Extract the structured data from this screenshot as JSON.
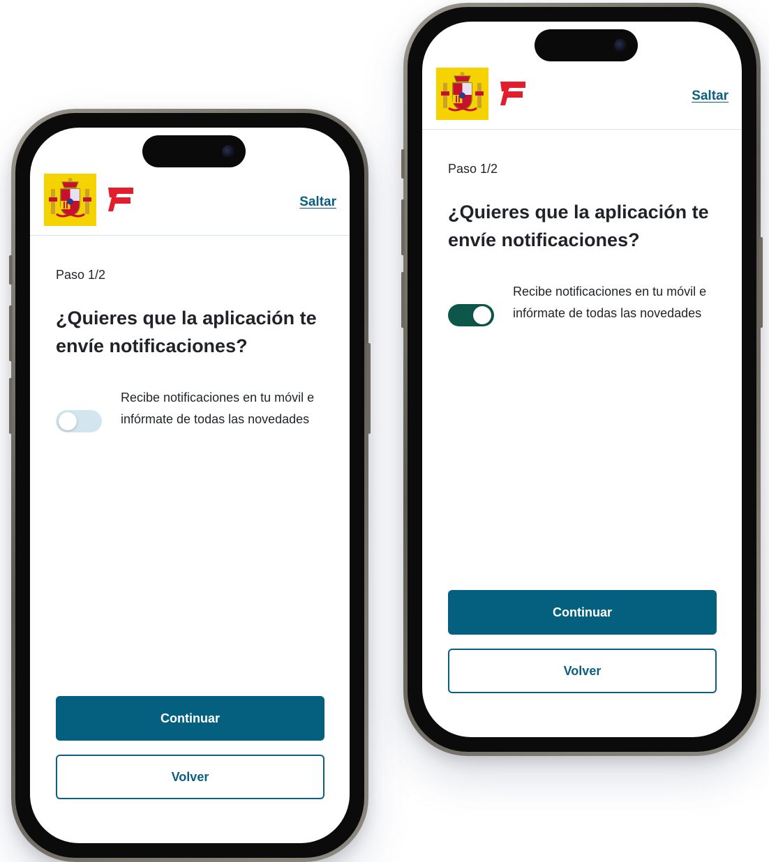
{
  "colors": {
    "primary": "#056080",
    "link": "#0a5f80",
    "toggle_on": "#0c5749",
    "toggle_off": "#d2e6ef",
    "coat_background": "#f4d300",
    "brand_red": "#e31d2b"
  },
  "icons": {
    "coat_of_arms": "spain-coat-of-arms-icon",
    "brand_logo": "brand-logo-icon"
  },
  "screens": [
    {
      "header": {
        "skip_label": "Saltar"
      },
      "step_label": "Paso 1/2",
      "title": "¿Quieres que la aplicación te envíe notificaciones?",
      "toggle": {
        "label": "Recibe notificaciones en tu móvil e infórmate de todas las novedades",
        "enabled": false
      },
      "actions": {
        "continue_label": "Continuar",
        "back_label": "Volver"
      }
    },
    {
      "header": {
        "skip_label": "Saltar"
      },
      "step_label": "Paso 1/2",
      "title": "¿Quieres que la aplicación te envíe notificaciones?",
      "toggle": {
        "label": "Recibe notificaciones en tu móvil e infórmate de todas las novedades",
        "enabled": true
      },
      "actions": {
        "continue_label": "Continuar",
        "back_label": "Volver"
      }
    }
  ]
}
